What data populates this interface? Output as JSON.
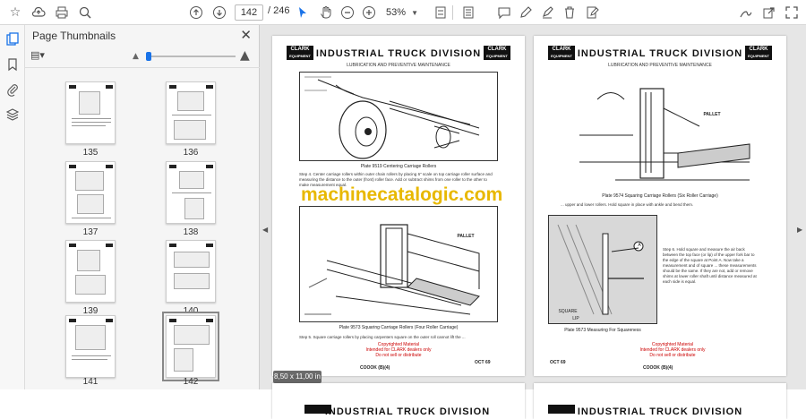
{
  "toolbar": {
    "page_current": "142",
    "page_total": "/ 246",
    "zoom": "53%"
  },
  "thumbnails_panel": {
    "title": "Page Thumbnails",
    "items": [
      {
        "label": "135"
      },
      {
        "label": "136"
      },
      {
        "label": "137"
      },
      {
        "label": "138"
      },
      {
        "label": "139"
      },
      {
        "label": "140"
      },
      {
        "label": "141"
      },
      {
        "label": "142"
      }
    ],
    "selected_page": "142"
  },
  "left_page": {
    "division_title": "INDUSTRIAL TRUCK DIVISION",
    "logo_text_1": "CLARK",
    "logo_text_2": "EQUIPMENT",
    "subtitle": "LUBRICATION AND PREVENTIVE MAINTENANCE",
    "plate_top": "Plate 9519 Centering Carriage Rollers",
    "step_text": "Step 4. Center carriage rollers within outer chain rollers by placing 6\" scale on top carriage roller surface and measuring the distance to the outer (front) roller face. Add or subtract shims from one roller to the other to make measurement equal.",
    "pallet_label": "PALLET",
    "plate_bottom": "Plate 9573 Squaring Carriage Rollers (Four Roller Carriage)",
    "step5_text": "Step 5. Square carriage rollers by placing carpenters square on the outer roll cannot lift the ...",
    "copyright": "Copyrighted Material\nIntended for CLARK dealers only\nDo not sell or distribute",
    "footer_left": "COOOK (B)(4)",
    "footer_right": "OCT 69"
  },
  "right_page": {
    "division_title": "INDUSTRIAL TRUCK DIVISION",
    "logo_text_1": "CLARK",
    "logo_text_2": "EQUIPMENT",
    "subtitle": "LUBRICATION AND PREVENTIVE MAINTENANCE",
    "pallet_label": "PALLET",
    "plate_top": "Plate 9574 Squaring Carriage Rollers (Six Roller Carriage)",
    "step_text": "... upper and lower rollers. Hold square in place with ankle and bend them.",
    "step6_text": "Step 6. Hold square and measure the air back between the top face (or lip) of the upper fork bar to the edge of the square at Point A. Now take a measurement and of square ... these measurements should be the same. If they are not, add or remove shims at lower roller shaft until distance measured at each side is equal.",
    "label_a": "A",
    "label_square": "SQUARE",
    "label_lip": "LIP",
    "plate_bottom": "Plate 9573 Measuring For Squareness",
    "copyright": "Copyrighted Material\nIntended for CLARK dealers only\nDo not sell or distribute",
    "footer_left": "OCT 69",
    "footer_right": "COOOK (B)(4)"
  },
  "next_page_title": "INDUSTRIAL TRUCK DIVISION",
  "watermark": "machinecatalogic.com",
  "page_size_badge": "8,50 x 11,00 in"
}
